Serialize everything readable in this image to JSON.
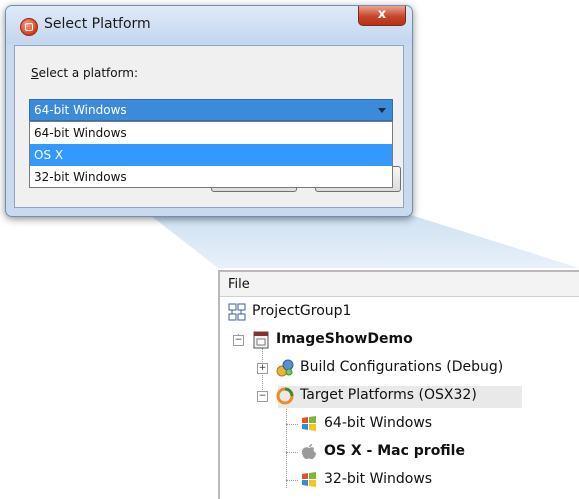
{
  "dialog": {
    "title": "Select Platform",
    "close_glyph": "x",
    "prompt_label_underlined": "S",
    "prompt_label_rest": "elect a platform:",
    "combo_value": "64-bit Windows",
    "options": [
      "64-bit Windows",
      "OS X",
      "32-bit Windows"
    ],
    "selected_option": "OS X"
  },
  "tree": {
    "menu_file": "File",
    "project_group": "ProjectGroup1",
    "project": "ImageShowDemo",
    "build_configurations": "Build Configurations (Debug)",
    "target_platforms": "Target Platforms (OSX32)",
    "platforms": {
      "win64": "64-bit Windows",
      "osx": "OS X - Mac profile",
      "win32": "32-bit Windows"
    }
  },
  "colors": {
    "selection_blue": "#3399ff",
    "combo_blue": "#3c8bdb",
    "dialog_frame": "#c9daef",
    "target_ring_orange": "#f08a24"
  }
}
